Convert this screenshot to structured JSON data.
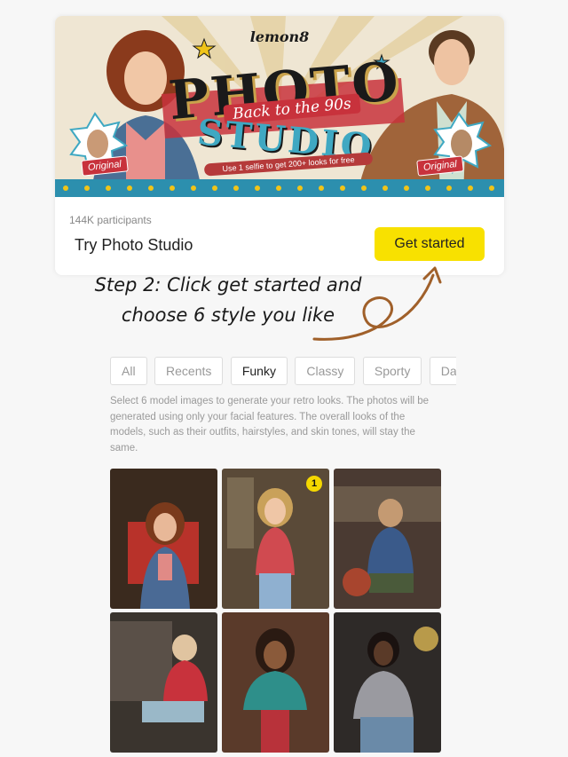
{
  "banner": {
    "logo": "lemon8",
    "title_top": "PHOTO",
    "title_sub": "Back to the 90s",
    "title_bottom": "STUDIO",
    "tagline": "Use 1 selfie to get 200+ looks for free",
    "original_left": "Original",
    "original_right": "Original"
  },
  "card": {
    "participants": "144K participants",
    "title": "Try Photo Studio",
    "button_label": "Get started"
  },
  "annotation": {
    "line1": "Step 2: Click get started and",
    "line2": "choose 6 style you like"
  },
  "tabs": [
    {
      "label": "All"
    },
    {
      "label": "Recents"
    },
    {
      "label": "Funky",
      "active": true
    },
    {
      "label": "Classy"
    },
    {
      "label": "Sporty"
    },
    {
      "label": "Daily"
    }
  ],
  "description": "Select 6 model images to generate your retro looks. The photos will be generated using only your facial features. The overall looks of the models, such as their outfits, hairstyles, and skin tones, will stay the same.",
  "models": [
    {
      "selected_index": null
    },
    {
      "selected_index": "1"
    },
    {
      "selected_index": null
    },
    {
      "selected_index": null
    },
    {
      "selected_index": null
    },
    {
      "selected_index": null
    }
  ],
  "colors": {
    "accent_yellow": "#f8e100",
    "banner_red": "#c8323c",
    "banner_teal": "#3fa8c2",
    "arrow_brown": "#a0602a"
  }
}
